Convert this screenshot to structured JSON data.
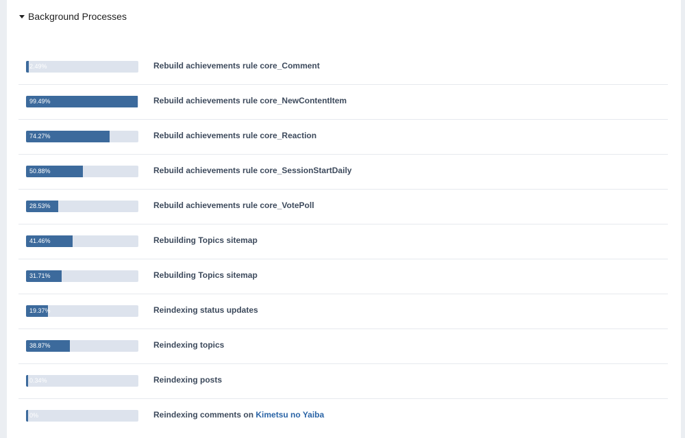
{
  "header": {
    "title": "Background Processes"
  },
  "processes": [
    {
      "progress": 2.49,
      "pct_label": "2.49%",
      "label": "Rebuild achievements rule core_Comment"
    },
    {
      "progress": 99.49,
      "pct_label": "99.49%",
      "label": "Rebuild achievements rule core_NewContentItem"
    },
    {
      "progress": 74.27,
      "pct_label": "74.27%",
      "label": "Rebuild achievements rule core_Reaction"
    },
    {
      "progress": 50.88,
      "pct_label": "50.88%",
      "label": "Rebuild achievements rule core_SessionStartDaily"
    },
    {
      "progress": 28.53,
      "pct_label": "28.53%",
      "label": "Rebuild achievements rule core_VotePoll"
    },
    {
      "progress": 41.46,
      "pct_label": "41.46%",
      "label": "Rebuilding Topics sitemap"
    },
    {
      "progress": 31.71,
      "pct_label": "31.71%",
      "label": "Rebuilding Topics sitemap"
    },
    {
      "progress": 19.37,
      "pct_label": "19.37%",
      "label": "Reindexing status updates"
    },
    {
      "progress": 38.87,
      "pct_label": "38.87%",
      "label": "Reindexing topics"
    },
    {
      "progress": 0.34,
      "pct_label": "0.34%",
      "label": "Reindexing posts"
    },
    {
      "progress": 0,
      "pct_label": "0%",
      "label": "Reindexing comments on ",
      "link": "Kimetsu no Yaiba"
    }
  ],
  "colors": {
    "fill": "#3c6a9c",
    "track": "#dde3ed",
    "link": "#2a64a6"
  }
}
